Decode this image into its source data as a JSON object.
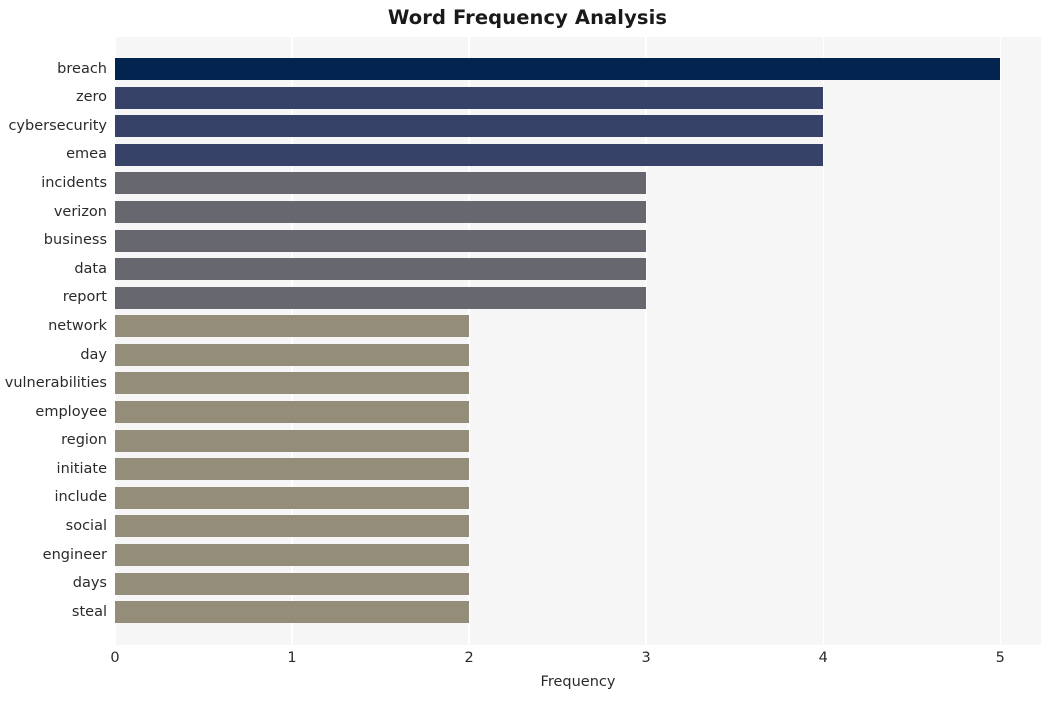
{
  "chart_data": {
    "type": "bar",
    "orientation": "horizontal",
    "title": "Word Frequency Analysis",
    "xlabel": "Frequency",
    "ylabel": "",
    "categories": [
      "breach",
      "zero",
      "cybersecurity",
      "emea",
      "incidents",
      "verizon",
      "business",
      "data",
      "report",
      "network",
      "day",
      "vulnerabilities",
      "employee",
      "region",
      "initiate",
      "include",
      "social",
      "engineer",
      "days",
      "steal"
    ],
    "values": [
      5,
      4,
      4,
      4,
      3,
      3,
      3,
      3,
      3,
      2,
      2,
      2,
      2,
      2,
      2,
      2,
      2,
      2,
      2,
      2
    ],
    "bar_colors": [
      "#042450",
      "#374269",
      "#374269",
      "#374269",
      "#66676f",
      "#66676f",
      "#66676f",
      "#66676f",
      "#66676f",
      "#948d79",
      "#948d79",
      "#948d79",
      "#948d79",
      "#948d79",
      "#948d79",
      "#948d79",
      "#948d79",
      "#948d79",
      "#948d79",
      "#948d79"
    ],
    "xlim": [
      0,
      5.23
    ],
    "xticks": [
      0,
      1,
      2,
      3,
      4,
      5
    ],
    "xtick_labels": [
      "0",
      "1",
      "2",
      "3",
      "4",
      "5"
    ],
    "grid": "vertical-white-on-gray",
    "legend": "none",
    "plot_background": "#f6f6f7",
    "figure_background": "#ffffff",
    "gridline_color": "#ffffff",
    "text_color": "#2b2b2b",
    "title_color": "#1a1a1a"
  }
}
